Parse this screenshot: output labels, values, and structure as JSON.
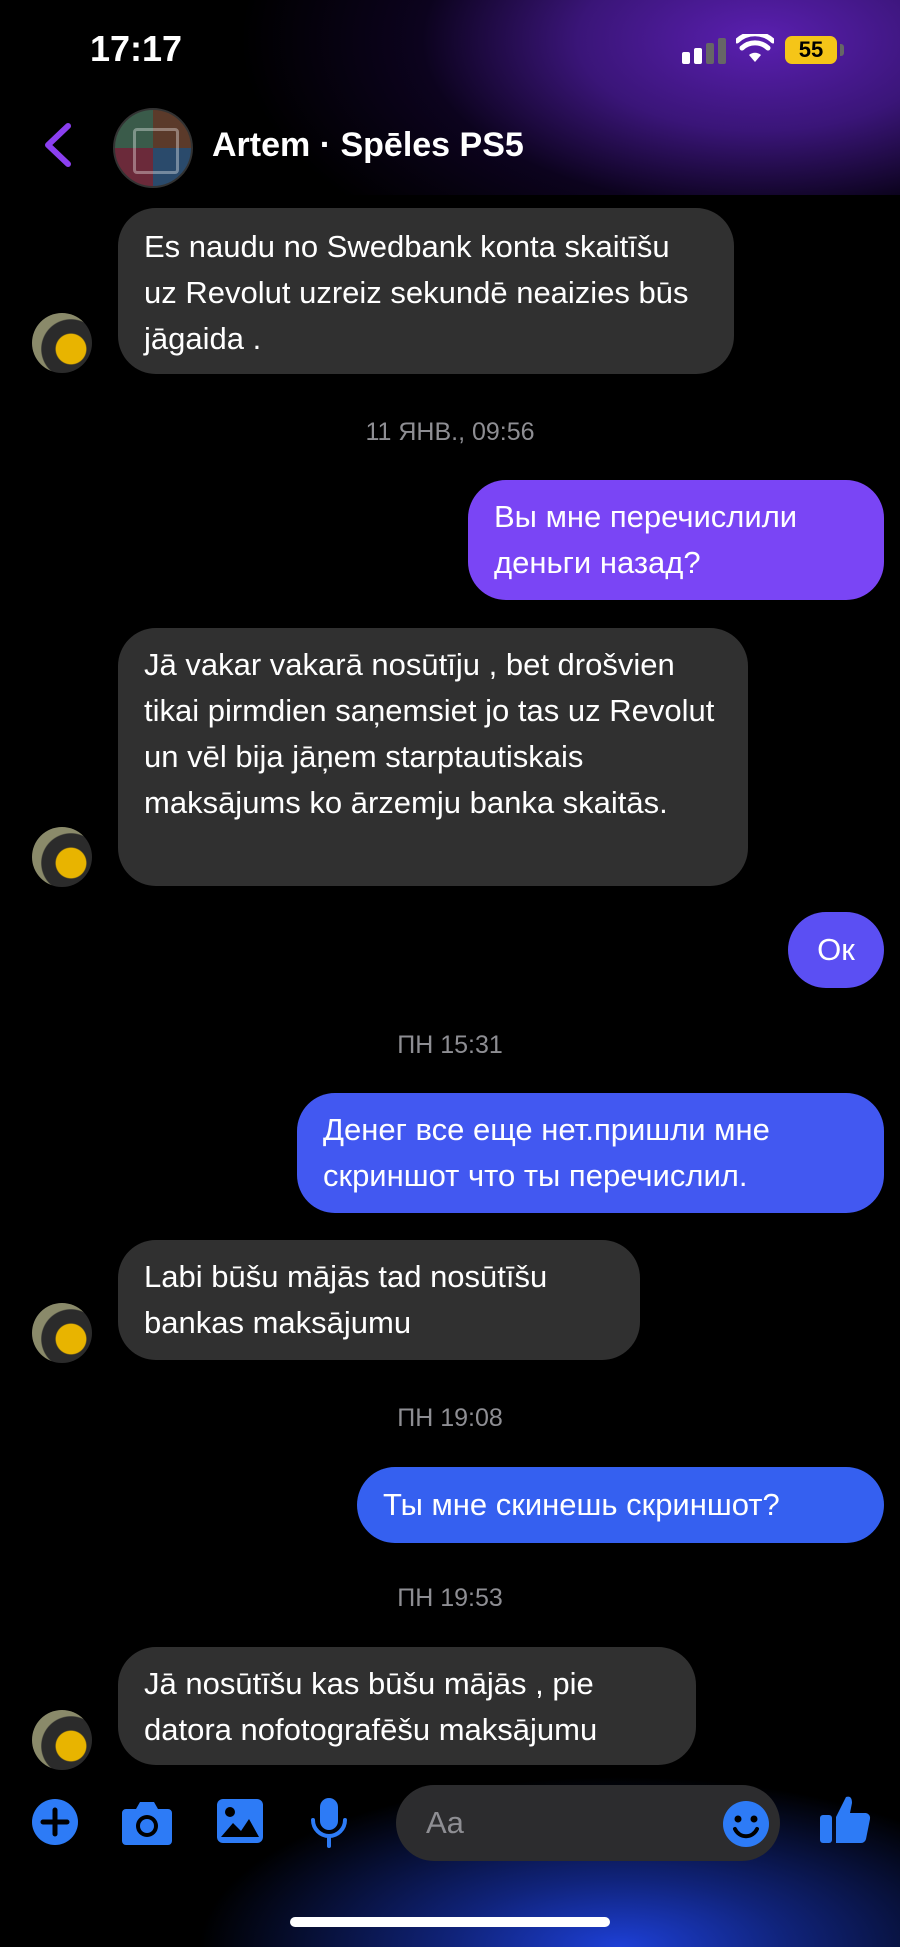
{
  "status": {
    "time": "17:17",
    "battery": "55"
  },
  "header": {
    "title": "Artem · Spēles PS5"
  },
  "messages": [
    {
      "text": "Es naudu no Swedbank konta skaitīšu uz Revolut uzreiz sekundē neaizies būs jāgaida ."
    },
    {
      "text": "11 ЯНВ., 09:56"
    },
    {
      "text": "Вы мне перечислили деньги назад?"
    },
    {
      "text": "Jā vakar vakarā nosūtīju , bet drošvien tikai pirmdien saņemsiet jo tas uz Revolut un vēl bija jāņem starptautiskais maksājums ko ārzemju banka skaitās."
    },
    {
      "text": "Ок"
    },
    {
      "text": "ПН 15:31"
    },
    {
      "text": "Денег все еще нет.пришли мне скриншот что ты перечислил."
    },
    {
      "text": "Labi būšu mājās tad nosūtīšu bankas maksājumu"
    },
    {
      "text": "ПН 19:08"
    },
    {
      "text": "Ты мне  скинешь скриншот?"
    },
    {
      "text": "ПН 19:53"
    },
    {
      "text": "Jā nosūtīšu kas būšu mājās , pie datora nofotografēšu maksājumu"
    }
  ],
  "composer": {
    "placeholder": "Aa"
  },
  "colors": {
    "accent": "#7b3ff2",
    "outgoing_top": "#7a45f5",
    "outgoing_bottom": "#2f5ef0",
    "icon_blue": "#2d7bf6"
  }
}
